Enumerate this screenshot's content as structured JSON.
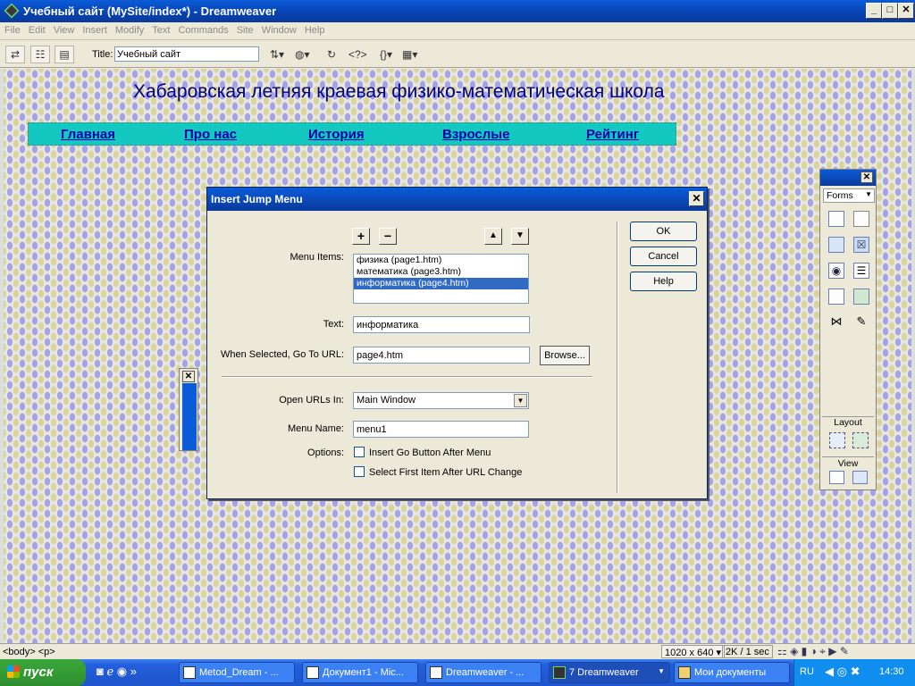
{
  "window": {
    "title": "Учебный сайт (MySite/index*) - Dreamweaver",
    "controls": [
      "_",
      "□",
      "✕"
    ]
  },
  "menubar": [
    "File",
    "Edit",
    "View",
    "Insert",
    "Modify",
    "Text",
    "Commands",
    "Site",
    "Window",
    "Help"
  ],
  "toolbar": {
    "title_label": "Title:",
    "title_value": "Учебный сайт"
  },
  "page": {
    "heading": "Хабаровская летняя краевая физико-математическая школа",
    "nav": [
      "Главная",
      "Про нас",
      "История",
      "Взрослые",
      "Рейтинг"
    ]
  },
  "dialog": {
    "title": "Insert Jump Menu",
    "close": "✕",
    "labels": {
      "menu_items": "Menu Items:",
      "text": "Text:",
      "goto_url": "When Selected, Go To URL:",
      "open_in": "Open URLs In:",
      "menu_name": "Menu Name:",
      "options": "Options:"
    },
    "list_buttons": {
      "add": "+",
      "remove": "−",
      "up": "▲",
      "down": "▼"
    },
    "menu_items": [
      "физика (page1.htm)",
      "математика (page3.htm)",
      "информатика (page4.htm)"
    ],
    "selected_index": 2,
    "text_value": "информатика",
    "url_value": "page4.htm",
    "browse_label": "Browse...",
    "open_in_value": "Main Window",
    "menu_name_value": "menu1",
    "option_go_button": "Insert Go Button After Menu",
    "option_select_first": "Select First Item After URL Change",
    "ok_label": "OK",
    "cancel_label": "Cancel",
    "help_label": "Help"
  },
  "insert_panel": {
    "category": "Forms",
    "layout_label": "Layout",
    "view_label": "View",
    "close": "✕"
  },
  "statusbar": {
    "tags": "<body> <p>",
    "size": "1020 x 640",
    "download": "2K / 1 sec"
  },
  "taskbar": {
    "start": "пуск",
    "tasks": [
      "Metod_Dream - ...",
      "Документ1 - Mic...",
      "Dreamweaver - ...",
      "7 Dreamweaver",
      "Мои документы"
    ],
    "lang": "RU",
    "time": "14:30"
  }
}
